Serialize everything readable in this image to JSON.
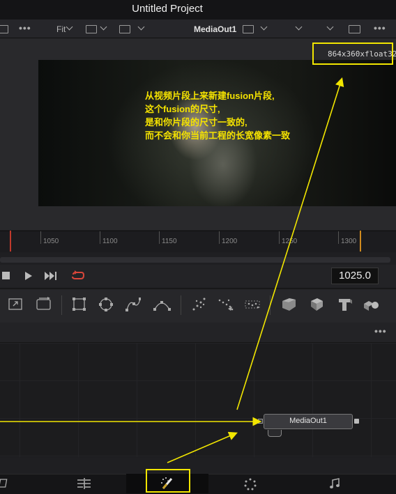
{
  "window": {
    "title": "Untitled Project"
  },
  "viewer_toolbar": {
    "zoom_label": "Fit",
    "viewer_name": "MediaOut1",
    "more_left": "•••",
    "more_right": "•••"
  },
  "viewer": {
    "resolution_label": "864x360xfloat32",
    "annotation_lines": [
      "从视频片段上来新建fusion片段,",
      "这个fusion的尺寸,",
      "是和你片段的尺寸一致的,",
      "而不会和你当前工程的长宽像素一致"
    ]
  },
  "timeline": {
    "tick_labels": [
      "1050",
      "1100",
      "1150",
      "1200",
      "1250",
      "1300"
    ],
    "current_frame": "1025.0"
  },
  "node_editor": {
    "more": "•••",
    "node_label": "MediaOut1"
  },
  "colors": {
    "highlight": "#f2e600",
    "playhead": "#c0392b",
    "loop_icon": "#d9463a"
  },
  "icons": {
    "transport": [
      "stop-icon",
      "play-icon",
      "next-icon",
      "loop-icon"
    ],
    "tools": [
      "resize-icon",
      "transform-icon",
      "rectangle-mask-icon",
      "ellipse-mask-icon",
      "polygon-mask-icon",
      "bspline-mask-icon",
      "particle-emitter-icon",
      "particle-render-icon",
      "particle-3d-icon",
      "shape-3d-icon",
      "image-plane-3d-icon",
      "text-3d-icon",
      "merge-3d-icon"
    ],
    "pages": [
      "media-page-icon",
      "edit-page-icon",
      "fusion-page-icon",
      "color-page-icon",
      "fairlight-page-icon"
    ]
  }
}
